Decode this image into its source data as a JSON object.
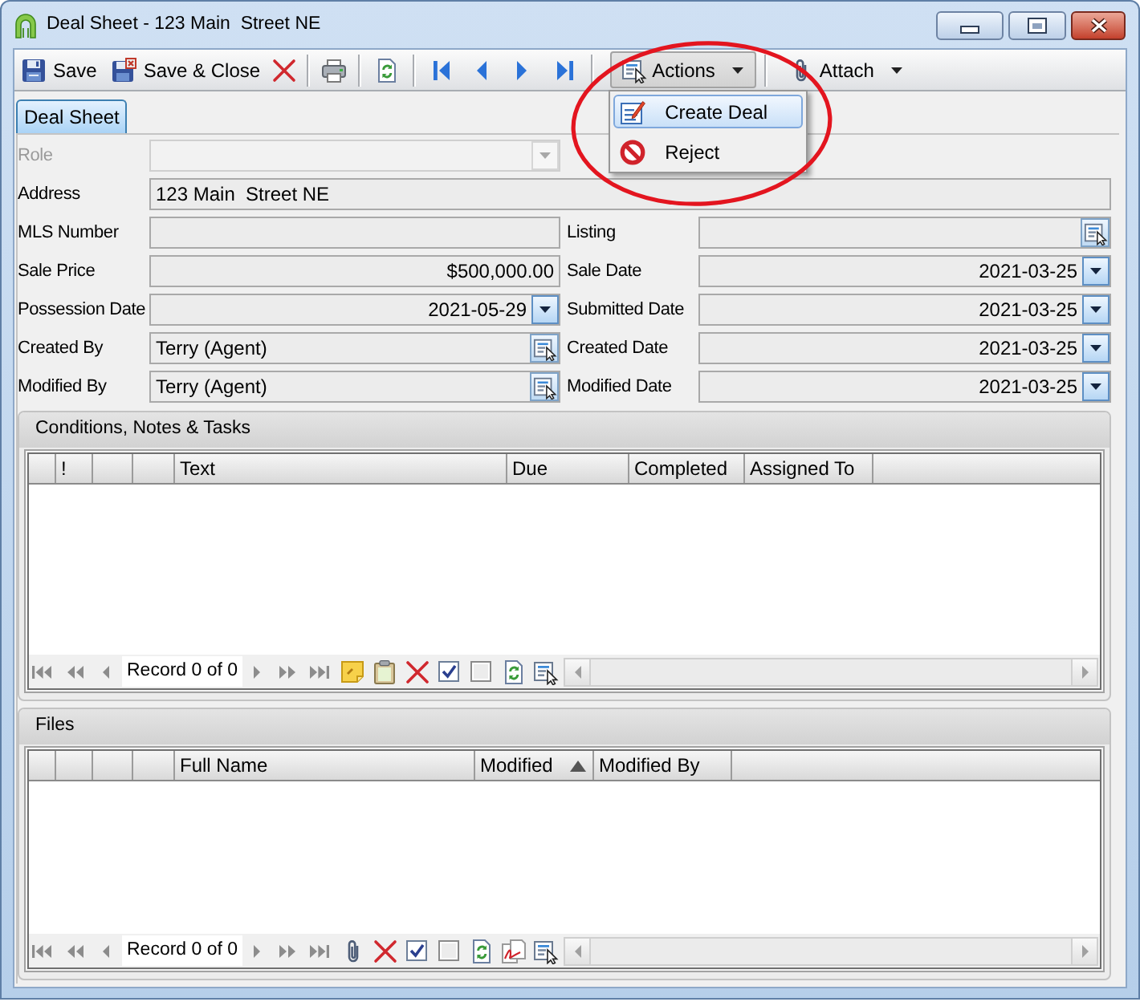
{
  "window": {
    "title": "Deal Sheet - 123 Main  Street NE"
  },
  "toolbar": [
    {
      "kind": "button",
      "label": "Save"
    },
    {
      "kind": "button",
      "label": "Save & Close"
    },
    {
      "kind": "icon_button"
    },
    {
      "kind": "separator"
    },
    {
      "kind": "icon_button"
    },
    {
      "kind": "separator"
    },
    {
      "kind": "icon_button"
    },
    {
      "kind": "separator"
    },
    {
      "kind": "icon_button"
    },
    {
      "kind": "icon_button"
    },
    {
      "kind": "icon_button"
    },
    {
      "kind": "icon_button"
    },
    {
      "kind": "separator"
    },
    {
      "kind": "menu_button",
      "label": "Actions",
      "expanded": true,
      "menu": [
        {
          "label": "Create Deal",
          "selected": true
        },
        {
          "label": "Reject",
          "selected": false
        }
      ]
    },
    {
      "kind": "separator"
    },
    {
      "kind": "menu_button",
      "label": "Attach",
      "expanded": false
    }
  ],
  "annotation": {
    "kind": "ellipse"
  },
  "tabs": [
    {
      "label": "Deal Sheet",
      "selected": true
    }
  ],
  "form": {
    "rows": [
      {
        "left": {
          "label": "Role",
          "kind": "dropdown",
          "disabled": true
        }
      },
      {
        "full": {
          "label": "Address",
          "kind": "text",
          "value": "123 Main  Street NE",
          "disabled": false
        }
      },
      {
        "left": {
          "label": "MLS Number",
          "kind": "text",
          "disabled": false
        },
        "right": {
          "label": "Listing",
          "kind": "lookup",
          "disabled": false
        }
      },
      {
        "left": {
          "label": "Sale Price",
          "kind": "number",
          "value": "$500,000.00",
          "disabled": false
        },
        "right": {
          "label": "Sale Date",
          "kind": "date",
          "value": "2021-03-25",
          "disabled": false
        }
      },
      {
        "left": {
          "label": "Possession Date",
          "kind": "date",
          "value": "2021-05-29",
          "disabled": false
        },
        "right": {
          "label": "Submitted Date",
          "kind": "date",
          "value": "2021-03-25",
          "disabled": false
        }
      },
      {
        "left": {
          "label": "Created By",
          "kind": "lookup",
          "value": "Terry (Agent)",
          "disabled": false
        },
        "right": {
          "label": "Created Date",
          "kind": "date",
          "value": "2021-03-25",
          "disabled": false
        }
      },
      {
        "left": {
          "label": "Modified By",
          "kind": "lookup",
          "value": "Terry (Agent)",
          "disabled": false
        },
        "right": {
          "label": "Modified Date",
          "kind": "date",
          "value": "2021-03-25",
          "disabled": false
        }
      }
    ]
  },
  "grids": [
    {
      "title": "Conditions, Notes & Tasks",
      "columns": [
        {
          "kind": "blank",
          "sorted": false
        },
        {
          "kind": "text",
          "label": "!",
          "sorted": false
        },
        {
          "kind": "blank",
          "sorted": false
        },
        {
          "kind": "blank",
          "sorted": false
        },
        {
          "kind": "text",
          "label": "Text",
          "sorted": false
        },
        {
          "kind": "text",
          "label": "Due",
          "sorted": false
        },
        {
          "kind": "text",
          "label": "Completed",
          "sorted": false
        },
        {
          "kind": "text",
          "label": "Assigned To",
          "sorted": false
        }
      ],
      "record_label": "Record 0 of 0"
    },
    {
      "title": "Files",
      "columns": [
        {
          "kind": "blank",
          "sorted": false
        },
        {
          "kind": "blank",
          "sorted": false
        },
        {
          "kind": "blank",
          "sorted": false
        },
        {
          "kind": "blank",
          "sorted": false
        },
        {
          "kind": "text",
          "label": "Full Name",
          "sorted": false
        },
        {
          "kind": "text",
          "label": "Modified",
          "sorted": true
        },
        {
          "kind": "text",
          "label": "Modified By",
          "sorted": false
        }
      ],
      "record_label": "Record 0 of 0"
    }
  ]
}
